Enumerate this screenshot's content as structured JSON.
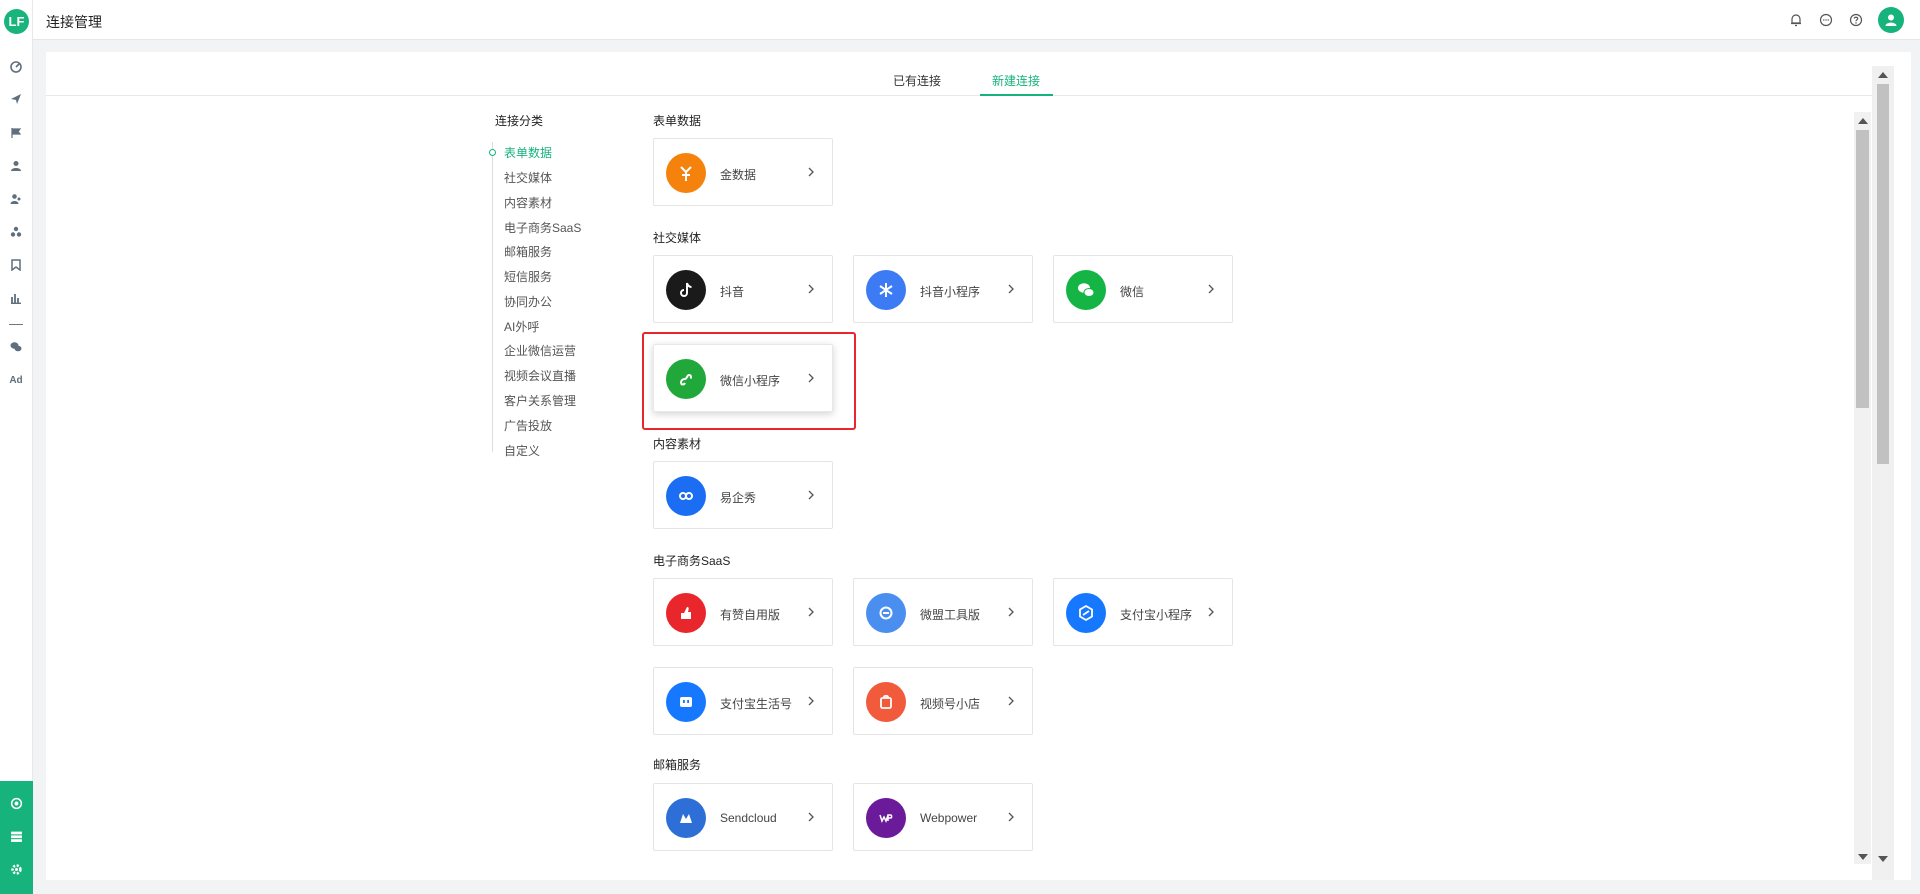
{
  "app": {
    "logo": "LF",
    "title": "连接管理"
  },
  "rail": {
    "icons": [
      "dashboard-icon",
      "send-icon",
      "flag-icon",
      "user-icon",
      "user-group-icon",
      "cluster-icon",
      "bookmark-icon",
      "bar-chart-icon",
      "wechat-icon",
      "ad-icon"
    ],
    "ad_label": "Ad",
    "bottom_icons": [
      "connection-icon",
      "list-icon",
      "settings-icon"
    ]
  },
  "topbar": {
    "icons": [
      "bell-icon",
      "chat-icon",
      "help-icon",
      "user-avatar"
    ]
  },
  "tabs": [
    {
      "label": "已有连接",
      "active": false
    },
    {
      "label": "新建连接",
      "active": true
    }
  ],
  "catnav": {
    "title": "连接分类",
    "items": [
      "表单数据",
      "社交媒体",
      "内容素材",
      "电子商务SaaS",
      "邮箱服务",
      "短信服务",
      "协同办公",
      "AI外呼",
      "企业微信运营",
      "视频会议直播",
      "客户关系管理",
      "广告投放",
      "自定义"
    ],
    "active_index": 0
  },
  "sections": [
    {
      "title": "表单数据",
      "cards": [
        {
          "label": "金数据",
          "color": "#f5820d"
        }
      ]
    },
    {
      "title": "社交媒体",
      "cards": [
        {
          "label": "抖音",
          "color": "#1a1a1a"
        },
        {
          "label": "抖音小程序",
          "color": "#3d7bf5"
        },
        {
          "label": "微信",
          "color": "#14b544"
        },
        {
          "label": "微信小程序",
          "color": "#20a83a"
        }
      ]
    },
    {
      "title": "内容素材",
      "cards": [
        {
          "label": "易企秀",
          "color": "#1b6ef3"
        }
      ]
    },
    {
      "title": "电子商务SaaS",
      "cards": [
        {
          "label": "有赞自用版",
          "color": "#e8262b"
        },
        {
          "label": "微盟工具版",
          "color": "#4a8ef0"
        },
        {
          "label": "支付宝小程序",
          "color": "#1677ff"
        },
        {
          "label": "支付宝生活号",
          "color": "#1677ff"
        },
        {
          "label": "视频号小店",
          "color": "#f25a3c"
        }
      ]
    },
    {
      "title": "邮箱服务",
      "cards": [
        {
          "label": "Sendcloud",
          "color": "#2d6fd6"
        },
        {
          "label": "Webpower",
          "color": "#6b1a9a"
        }
      ]
    }
  ],
  "highlight": {
    "label": "微信小程序",
    "color": "#e8262b"
  }
}
